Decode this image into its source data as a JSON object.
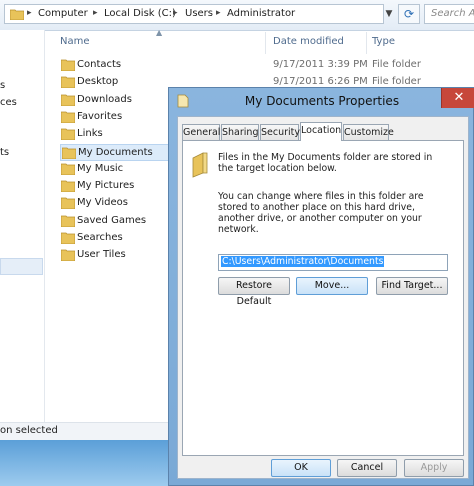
{
  "address": {
    "crumbs": [
      "Computer",
      "Local Disk (C:)",
      "Users",
      "Administrator"
    ],
    "separator": "▸",
    "search_placeholder": "Search Ad"
  },
  "nav": {
    "partial_items": [
      "s",
      "ces",
      "ts"
    ]
  },
  "columns": {
    "name": "Name",
    "date": "Date modified",
    "type": "Type"
  },
  "files": [
    {
      "name": "Contacts",
      "date": "9/17/2011 3:39 PM",
      "type": "File folder"
    },
    {
      "name": "Desktop",
      "date": "9/17/2011 6:26 PM",
      "type": "File folder"
    },
    {
      "name": "Downloads",
      "date": "",
      "type": ""
    },
    {
      "name": "Favorites",
      "date": "",
      "type": ""
    },
    {
      "name": "Links",
      "date": "",
      "type": ""
    },
    {
      "name": "My Documents",
      "date": "",
      "type": "",
      "selected": true
    },
    {
      "name": "My Music",
      "date": "",
      "type": ""
    },
    {
      "name": "My Pictures",
      "date": "",
      "type": ""
    },
    {
      "name": "My Videos",
      "date": "",
      "type": ""
    },
    {
      "name": "Saved Games",
      "date": "",
      "type": ""
    },
    {
      "name": "Searches",
      "date": "",
      "type": ""
    },
    {
      "name": "User Tiles",
      "date": "",
      "type": ""
    }
  ],
  "status": {
    "text": "on selected"
  },
  "dialog": {
    "title": "My Documents Properties",
    "close_glyph": "✕",
    "tabs": [
      "General",
      "Sharing",
      "Security",
      "Location",
      "Customize"
    ],
    "active_tab": "Location",
    "info_text": "Files in the My Documents folder are stored in the target location below.",
    "change_text": "You can change where files in this folder are stored to another place on this hard drive, another drive, or another computer on your network.",
    "path_value": "C:\\Users\\Administrator\\Documents",
    "buttons": {
      "restore": "Restore Default",
      "move": "Move...",
      "find": "Find Target..."
    },
    "footer": {
      "ok": "OK",
      "cancel": "Cancel",
      "apply": "Apply"
    }
  },
  "colors": {
    "folder": "#e8c35a",
    "accent": "#3399ff",
    "close": "#c7473a"
  }
}
